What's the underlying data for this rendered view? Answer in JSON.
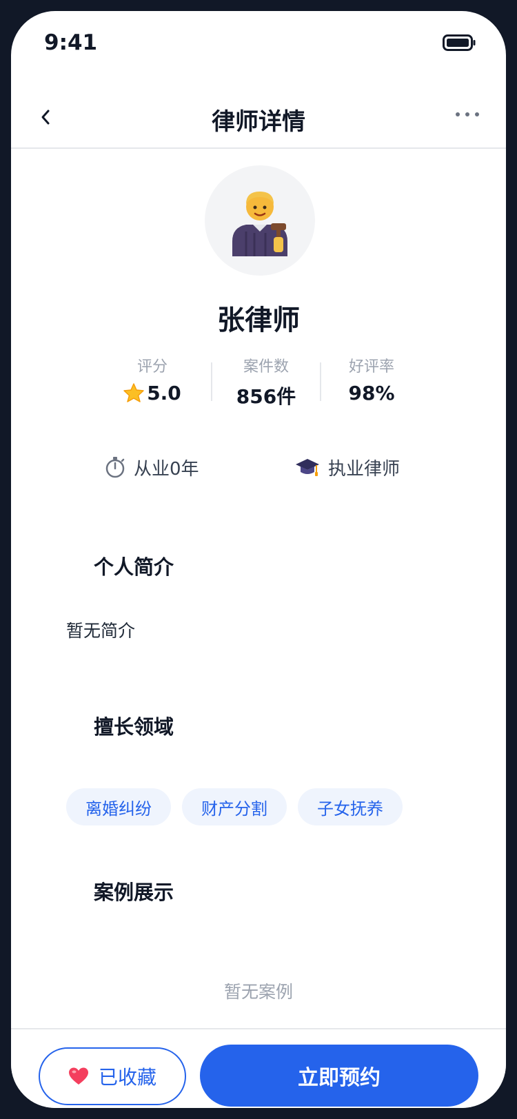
{
  "status_bar": {
    "time": "9:41"
  },
  "nav": {
    "title": "律师详情"
  },
  "lawyer": {
    "name": "张律师",
    "stats": {
      "rating_label": "评分",
      "rating_value": "5.0",
      "cases_label": "案件数",
      "cases_value": "856件",
      "praise_label": "好评率",
      "praise_value": "98%"
    },
    "experience": "从业0年",
    "title": "执业律师"
  },
  "sections": {
    "intro_title": "个人简介",
    "intro_text": "暂无简介",
    "expertise_title": "擅长领域",
    "expertise_tags": [
      "离婚纠纷",
      "财产分割",
      "子女抚养"
    ],
    "cases_title": "案例展示",
    "cases_empty": "暂无案例"
  },
  "actions": {
    "favorite_label": "已收藏",
    "book_label": "立即预约"
  },
  "colors": {
    "accent": "#2563eb",
    "frame": "#111827",
    "tag_bg": "#eff4fd"
  },
  "icons": [
    "back-icon",
    "more-icon",
    "battery-icon",
    "judge-avatar-icon",
    "star-icon",
    "stopwatch-icon",
    "graduation-cap-icon",
    "heart-icon"
  ]
}
